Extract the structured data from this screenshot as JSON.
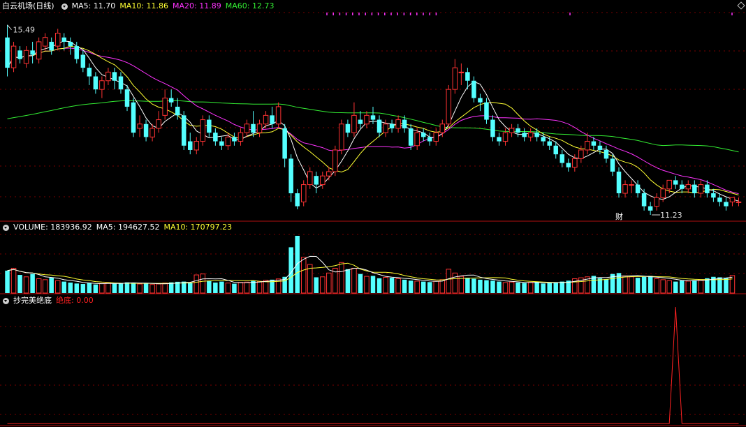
{
  "header": {
    "stock_title": "白云机场(日线)",
    "ma_labels": [
      {
        "text": "MA5: 11.70",
        "color": "#ffffff"
      },
      {
        "text": "MA10: 11.86",
        "color": "#ffff33"
      },
      {
        "text": "MA20: 11.89",
        "color": "#ff33ff"
      },
      {
        "text": "MA60: 12.73",
        "color": "#33ee33"
      }
    ]
  },
  "volume_header": [
    {
      "text": "VOLUME: 183936.92",
      "color": "#ffffff"
    },
    {
      "text": "MA5: 194627.52",
      "color": "#ffffff"
    },
    {
      "text": "MA10: 170797.23",
      "color": "#ffff33"
    }
  ],
  "indicator_header": {
    "name": "抄完美绝底",
    "name_color": "#ffffff",
    "value_text": "绝底: 0.00",
    "value_color": "#ff2222"
  },
  "annotations": {
    "high_label": "15.49",
    "low_label": "11.23",
    "finance_marker": "财"
  },
  "colors": {
    "up": "#ff3333",
    "down": "#54ffff",
    "grid": "#7a0000",
    "ma5": "#ffffff",
    "ma10": "#ffff33",
    "ma20": "#ff33ff",
    "ma60": "#33ee33",
    "indicator": "#ff2222"
  },
  "chart_data": [
    {
      "type": "candlestick",
      "price_range": [
        11.1,
        15.55
      ],
      "high_point": 15.49,
      "low_point": 11.23,
      "candles": [
        [
          15.2,
          14.5,
          15.49,
          14.3
        ],
        [
          14.5,
          15.0,
          15.1,
          14.4
        ],
        [
          14.9,
          14.7,
          15.0,
          14.6
        ],
        [
          14.6,
          14.9,
          15.0,
          14.5
        ],
        [
          14.9,
          14.8,
          15.1,
          14.6
        ],
        [
          14.7,
          15.1,
          15.2,
          14.6
        ],
        [
          15.0,
          15.2,
          15.3,
          14.9
        ],
        [
          15.1,
          14.9,
          15.2,
          14.8
        ],
        [
          15.0,
          15.3,
          15.4,
          14.9
        ],
        [
          15.2,
          15.1,
          15.3,
          14.9
        ],
        [
          15.1,
          15.0,
          15.2,
          14.8
        ],
        [
          15.0,
          14.7,
          15.1,
          14.6
        ],
        [
          14.8,
          14.5,
          14.9,
          14.4
        ],
        [
          14.5,
          14.3,
          14.6,
          14.1
        ],
        [
          14.3,
          14.0,
          14.4,
          13.9
        ],
        [
          14.0,
          14.2,
          14.3,
          13.8
        ],
        [
          14.2,
          14.4,
          14.5,
          14.1
        ],
        [
          14.4,
          14.2,
          14.5,
          14.0
        ],
        [
          14.3,
          14.0,
          14.4,
          13.9
        ],
        [
          14.0,
          13.6,
          14.1,
          13.5
        ],
        [
          13.7,
          13.0,
          13.8,
          12.9
        ],
        [
          13.1,
          13.2,
          13.4,
          12.9
        ],
        [
          13.2,
          12.9,
          13.3,
          12.8
        ],
        [
          12.9,
          13.1,
          13.2,
          12.8
        ],
        [
          13.1,
          13.3,
          13.5,
          13.0
        ],
        [
          13.4,
          13.8,
          14.0,
          13.3
        ],
        [
          13.8,
          13.7,
          14.0,
          13.6
        ],
        [
          13.6,
          13.4,
          13.8,
          13.3
        ],
        [
          13.4,
          12.7,
          13.5,
          12.6
        ],
        [
          12.8,
          12.6,
          13.0,
          12.5
        ],
        [
          12.6,
          12.8,
          12.9,
          12.5
        ],
        [
          12.8,
          13.3,
          13.4,
          12.7
        ],
        [
          13.3,
          13.0,
          13.4,
          12.9
        ],
        [
          13.0,
          12.8,
          13.1,
          12.7
        ],
        [
          12.8,
          12.7,
          12.9,
          12.6
        ],
        [
          12.7,
          12.9,
          13.0,
          12.6
        ],
        [
          12.9,
          12.8,
          13.0,
          12.7
        ],
        [
          12.8,
          13.0,
          13.1,
          12.7
        ],
        [
          13.0,
          13.2,
          13.3,
          12.9
        ],
        [
          13.2,
          13.0,
          13.5,
          12.9
        ],
        [
          13.0,
          13.2,
          13.3,
          12.9
        ],
        [
          13.2,
          13.4,
          13.5,
          13.1
        ],
        [
          13.4,
          13.2,
          13.6,
          13.1
        ],
        [
          13.2,
          13.6,
          13.7,
          13.1
        ],
        [
          13.1,
          12.4,
          13.2,
          12.2
        ],
        [
          12.4,
          11.6,
          12.5,
          11.4
        ],
        [
          11.6,
          11.3,
          11.7,
          11.23
        ],
        [
          11.4,
          11.8,
          11.9,
          11.3
        ],
        [
          11.8,
          12.1,
          12.2,
          11.7
        ],
        [
          12.0,
          11.8,
          12.1,
          11.6
        ],
        [
          11.8,
          12.0,
          12.1,
          11.7
        ],
        [
          12.0,
          12.1,
          12.2,
          11.9
        ],
        [
          12.1,
          12.6,
          12.7,
          12.0
        ],
        [
          12.6,
          13.2,
          13.3,
          12.5
        ],
        [
          13.2,
          13.0,
          13.3,
          12.9
        ],
        [
          13.0,
          13.4,
          13.7,
          12.9
        ],
        [
          13.3,
          13.2,
          13.5,
          13.1
        ],
        [
          13.2,
          13.4,
          13.5,
          13.1
        ],
        [
          13.4,
          13.3,
          13.6,
          13.2
        ],
        [
          13.3,
          13.0,
          13.4,
          12.9
        ],
        [
          13.0,
          13.2,
          13.3,
          12.9
        ],
        [
          13.2,
          13.1,
          13.3,
          13.0
        ],
        [
          13.1,
          13.3,
          13.4,
          13.0
        ],
        [
          13.3,
          13.1,
          13.4,
          13.0
        ],
        [
          13.1,
          12.7,
          13.2,
          12.6
        ],
        [
          12.7,
          13.0,
          13.1,
          12.6
        ],
        [
          13.0,
          12.9,
          13.1,
          12.8
        ],
        [
          12.9,
          12.8,
          13.0,
          12.7
        ],
        [
          12.8,
          13.0,
          13.1,
          12.7
        ],
        [
          13.0,
          13.2,
          13.3,
          12.9
        ],
        [
          13.2,
          14.0,
          14.1,
          13.1
        ],
        [
          14.0,
          14.5,
          14.7,
          13.9
        ],
        [
          14.4,
          14.4,
          14.6,
          14.1
        ],
        [
          14.4,
          14.2,
          14.5,
          14.0
        ],
        [
          14.2,
          13.8,
          14.3,
          13.7
        ],
        [
          13.8,
          13.7,
          13.9,
          13.5
        ],
        [
          13.7,
          13.3,
          13.8,
          13.2
        ],
        [
          13.3,
          12.9,
          13.4,
          12.8
        ],
        [
          12.9,
          12.8,
          13.0,
          12.7
        ],
        [
          12.8,
          13.0,
          13.1,
          12.7
        ],
        [
          13.0,
          13.1,
          13.2,
          12.9
        ],
        [
          13.1,
          13.0,
          13.2,
          12.9
        ],
        [
          13.0,
          12.9,
          13.1,
          12.8
        ],
        [
          12.9,
          13.0,
          13.1,
          12.8
        ],
        [
          13.0,
          12.9,
          13.1,
          12.8
        ],
        [
          12.9,
          12.8,
          13.0,
          12.7
        ],
        [
          12.8,
          12.7,
          12.9,
          12.6
        ],
        [
          12.7,
          12.5,
          12.8,
          12.4
        ],
        [
          12.5,
          12.3,
          12.6,
          12.2
        ],
        [
          12.3,
          12.2,
          12.4,
          12.1
        ],
        [
          12.2,
          12.4,
          12.5,
          12.1
        ],
        [
          12.4,
          12.6,
          12.7,
          12.3
        ],
        [
          12.6,
          12.8,
          13.0,
          12.5
        ],
        [
          12.8,
          12.7,
          12.9,
          12.6
        ],
        [
          12.7,
          12.6,
          12.8,
          12.5
        ],
        [
          12.6,
          12.4,
          12.7,
          12.3
        ],
        [
          12.4,
          12.1,
          12.5,
          12.0
        ],
        [
          12.1,
          11.6,
          12.2,
          11.5
        ],
        [
          11.6,
          11.8,
          11.9,
          11.5
        ],
        [
          11.8,
          11.8,
          11.9,
          11.6
        ],
        [
          11.8,
          11.6,
          11.9,
          11.5
        ],
        [
          11.6,
          11.3,
          11.7,
          11.2
        ],
        [
          11.3,
          11.2,
          11.4,
          11.1
        ],
        [
          11.3,
          11.5,
          11.6,
          11.2
        ],
        [
          11.5,
          11.7,
          11.8,
          11.4
        ],
        [
          11.7,
          11.9,
          11.9,
          11.6
        ],
        [
          11.9,
          11.8,
          12.0,
          11.7
        ],
        [
          11.8,
          11.7,
          11.9,
          11.6
        ],
        [
          11.7,
          11.8,
          11.9,
          11.6
        ],
        [
          11.8,
          11.6,
          11.9,
          11.5
        ],
        [
          11.6,
          11.8,
          11.9,
          11.5
        ],
        [
          11.8,
          11.6,
          11.9,
          11.5
        ],
        [
          11.6,
          11.5,
          11.7,
          11.4
        ],
        [
          11.5,
          11.4,
          11.6,
          11.3
        ],
        [
          11.4,
          11.3,
          11.5,
          11.2
        ],
        [
          11.4,
          11.5,
          11.5,
          11.3
        ],
        [
          11.4,
          11.4,
          11.5,
          11.3
        ]
      ]
    },
    {
      "type": "bar",
      "name": "VOLUME",
      "values": [
        235000,
        260000,
        190000,
        170000,
        200000,
        150000,
        140000,
        160000,
        130000,
        120000,
        110000,
        100000,
        95000,
        105000,
        90000,
        100000,
        110000,
        98000,
        105000,
        112000,
        110000,
        95000,
        100000,
        90000,
        95000,
        105000,
        112000,
        118000,
        120000,
        110000,
        190000,
        200000,
        130000,
        110000,
        120000,
        105000,
        98000,
        112000,
        115000,
        128000,
        122000,
        135000,
        140000,
        148000,
        170000,
        480000,
        600000,
        375000,
        300000,
        165000,
        170000,
        210000,
        260000,
        320000,
        250000,
        260000,
        200000,
        175000,
        180000,
        155000,
        165000,
        160000,
        150000,
        140000,
        130000,
        125000,
        120000,
        115000,
        125000,
        140000,
        250000,
        210000,
        175000,
        160000,
        150000,
        140000,
        135000,
        130000,
        120000,
        110000,
        115000,
        110000,
        105000,
        112000,
        118000,
        100000,
        105000,
        110000,
        120000,
        130000,
        150000,
        160000,
        170000,
        180000,
        155000,
        145000,
        200000,
        210000,
        180000,
        170000,
        160000,
        170000,
        180000,
        150000,
        140000,
        130000,
        120000,
        130000,
        125000,
        135000,
        140000,
        155000,
        170000,
        165000,
        160000,
        183936.92
      ]
    },
    {
      "type": "line",
      "name": "绝底",
      "values_by_candle": "0 everywhere except one spike to 1 at the 107th candle",
      "spike_index": 106,
      "spike_value": 1
    }
  ]
}
